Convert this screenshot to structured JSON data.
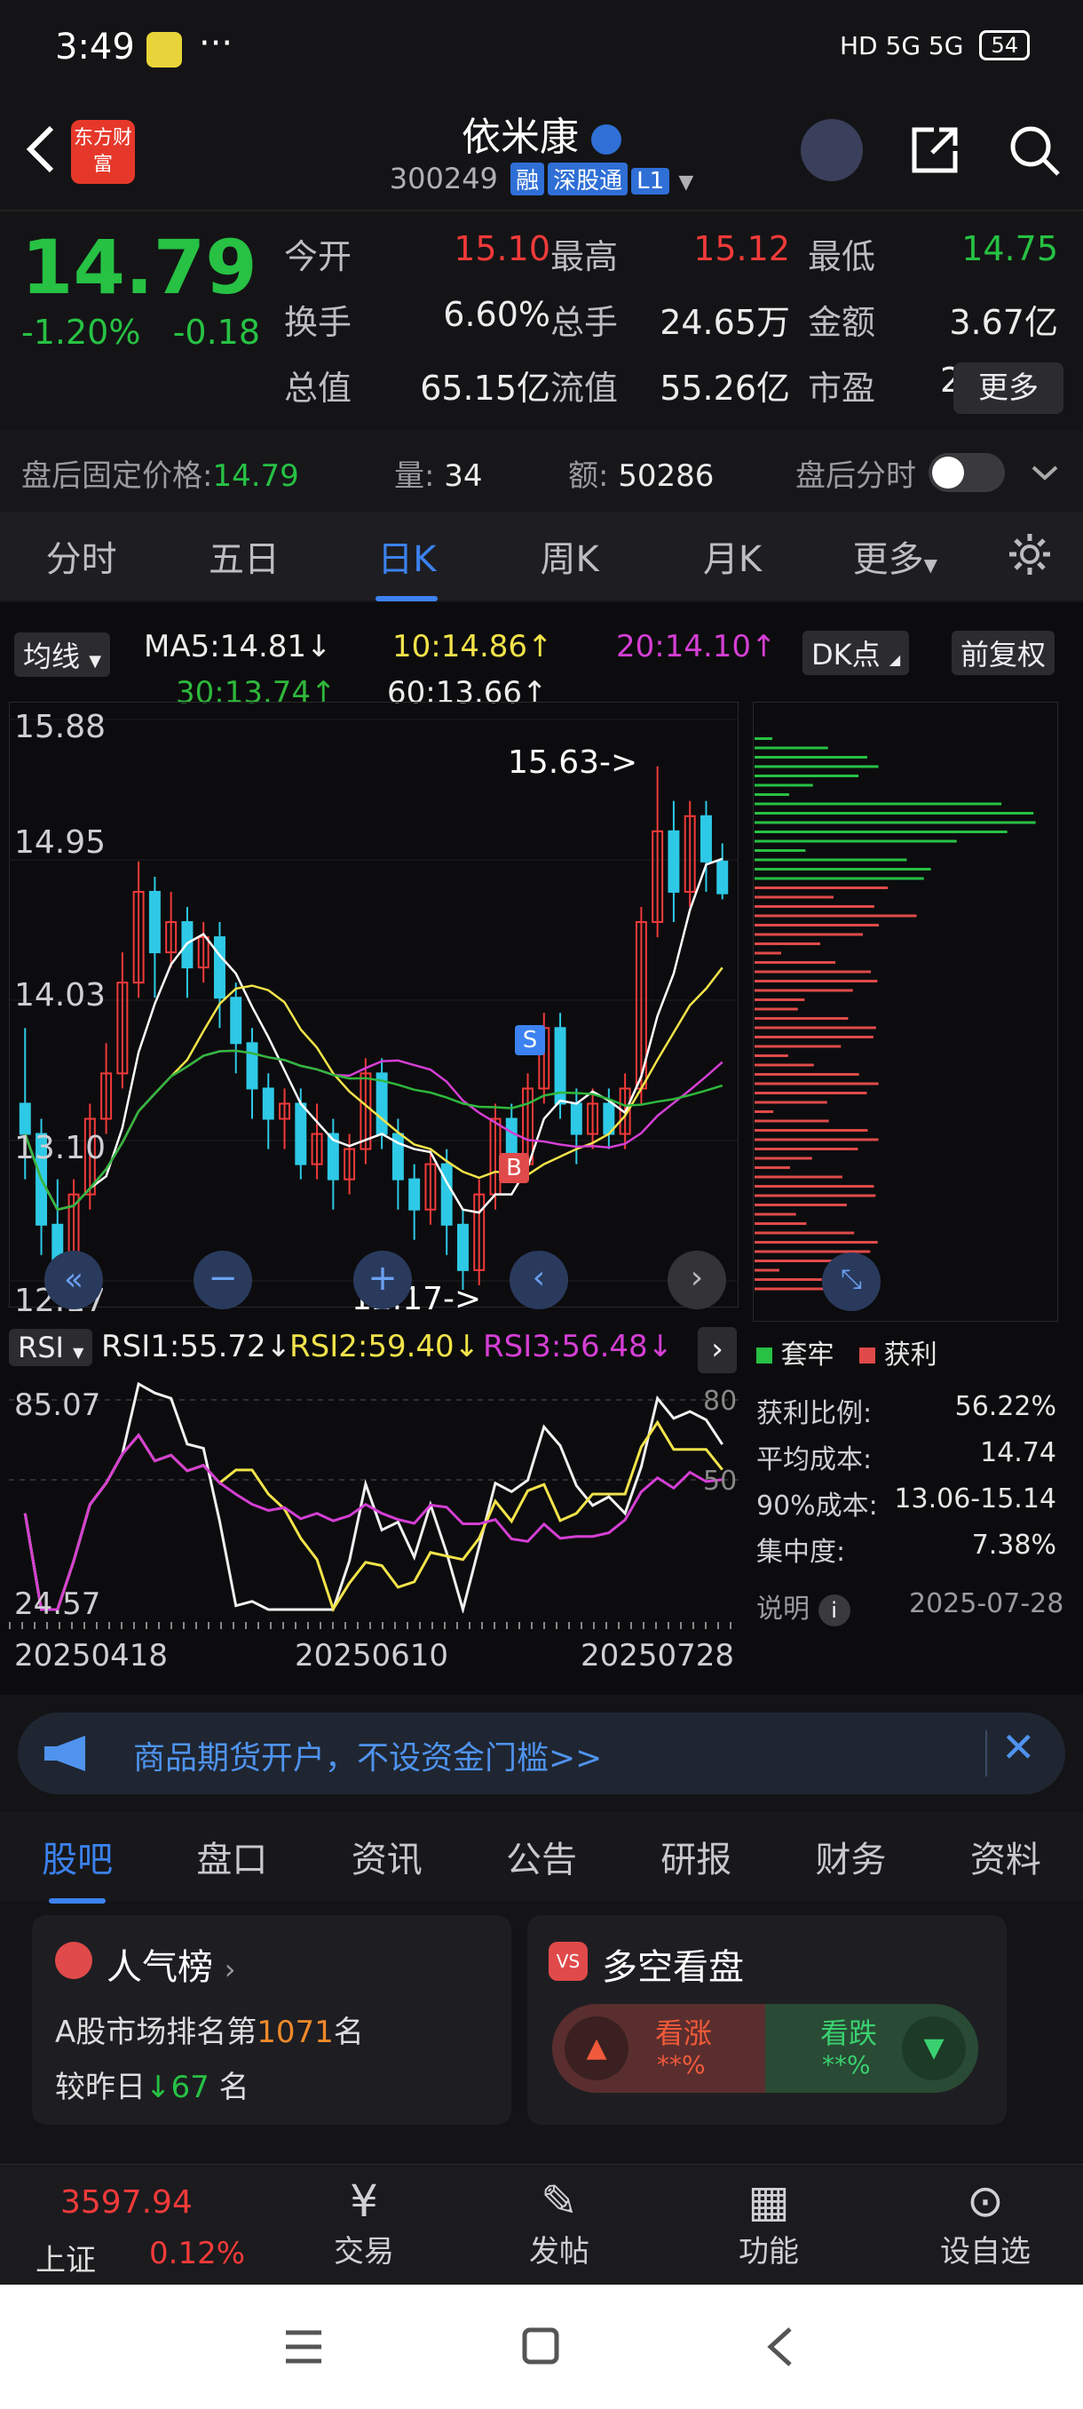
{
  "status_bar": {
    "time": "3:49",
    "dots": "···",
    "net": "HD 5G 5G",
    "battery": "54"
  },
  "header": {
    "title": "依米康",
    "code": "300249",
    "tags": [
      "融",
      "深股通",
      "L1"
    ],
    "logo_text": "东方财富"
  },
  "quote": {
    "price": "14.79",
    "change_pct": "-1.20%",
    "change": "-0.18",
    "fields": [
      {
        "label": "今开",
        "value": "15.10",
        "color": "red"
      },
      {
        "label": "最高",
        "value": "15.12",
        "color": "red"
      },
      {
        "label": "最低",
        "value": "14.75",
        "color": "green"
      },
      {
        "label": "换手",
        "value": "6.60%",
        "color": "white"
      },
      {
        "label": "总手",
        "value": "24.65万",
        "color": "white"
      },
      {
        "label": "金额",
        "value": "3.67亿",
        "color": "white"
      },
      {
        "label": "总值",
        "value": "65.15亿",
        "color": "white"
      },
      {
        "label": "流值",
        "value": "55.26亿",
        "color": "white"
      },
      {
        "label": "市盈",
        "value": "231.37",
        "color": "white"
      }
    ],
    "more": "更多",
    "after_hours": {
      "label": "盘后固定价格:",
      "price": "14.79",
      "vol_label": "量:",
      "vol": "34",
      "amt_label": "额:",
      "amt": "50286",
      "timeline_label": "盘后分时"
    }
  },
  "tabs": [
    "分时",
    "五日",
    "日K",
    "周K",
    "月K",
    "更多"
  ],
  "active_tab": 2,
  "chart": {
    "ma_selector": "均线",
    "ma": {
      "ma5": "MA5:14.81",
      "ma10": "10:14.86",
      "ma20": "20:14.10",
      "ma30": "30:13.74",
      "ma60": "60:13.66"
    },
    "dk": "DK点",
    "adjust": "前复权",
    "yticks": [
      "15.88",
      "14.95",
      "14.03",
      "13.10",
      "12.17"
    ],
    "high_label": "15.63->",
    "low_label": "12.17->",
    "rsi": {
      "selector": "RSI",
      "rsi1": "RSI1:55.72",
      "rsi2": "RSI2:59.40",
      "rsi3": "RSI3:56.48",
      "top": "85.07",
      "bottom": "24.57",
      "line80": "80",
      "line50": "50"
    },
    "dates": [
      "20250418",
      "20250610",
      "20250728"
    ],
    "chip_legend": {
      "trapped": "套牢",
      "profit": "获利"
    },
    "chip_stats": [
      {
        "label": "获利比例:",
        "value": "56.22%"
      },
      {
        "label": "平均成本:",
        "value": "14.74"
      },
      {
        "label": "90%成本:",
        "value": "13.06-15.14"
      },
      {
        "label": "集中度:",
        "value": "7.38%"
      }
    ],
    "note_label": "说明",
    "note_date": "2025-07-28"
  },
  "banner": {
    "text": "商品期货开户，不设资金门槛>>"
  },
  "bottom_tabs": [
    "股吧",
    "盘口",
    "资讯",
    "公告",
    "研报",
    "财务",
    "资料"
  ],
  "popularity": {
    "title": "人气榜",
    "rank_prefix": "A股市场排名第",
    "rank": "1071",
    "rank_suffix": "名",
    "change_prefix": "较昨日",
    "change": "67",
    "change_suffix": "名"
  },
  "longshort": {
    "title": "多空看盘",
    "up": "看涨",
    "up_val": "**%",
    "down": "看跌",
    "down_val": "**%"
  },
  "nav": {
    "index_value": "3597.94",
    "index_name": "上证",
    "index_pct": "0.12%",
    "items": [
      "交易",
      "发帖",
      "功能",
      "设自选"
    ]
  },
  "chart_data": {
    "type": "candlestick",
    "x_labels": [
      "20250418",
      "20250610",
      "20250728"
    ],
    "ylim": [
      12.17,
      15.88
    ],
    "candles": [
      [
        13.4,
        13.2,
        13.9,
        12.9
      ],
      [
        13.2,
        12.6,
        13.3,
        12.4
      ],
      [
        12.6,
        12.3,
        12.9,
        12.17
      ],
      [
        12.3,
        12.8,
        12.9,
        12.2
      ],
      [
        12.8,
        13.3,
        13.4,
        12.7
      ],
      [
        13.3,
        13.6,
        13.8,
        13.2
      ],
      [
        13.6,
        14.2,
        14.4,
        13.5
      ],
      [
        14.2,
        14.8,
        15.0,
        14.1
      ],
      [
        14.8,
        14.4,
        14.9,
        14.1
      ],
      [
        14.4,
        14.6,
        14.8,
        14.3
      ],
      [
        14.6,
        14.3,
        14.7,
        14.1
      ],
      [
        14.3,
        14.5,
        14.6,
        14.2
      ],
      [
        14.5,
        14.1,
        14.6,
        13.9
      ],
      [
        14.1,
        13.8,
        14.2,
        13.6
      ],
      [
        13.8,
        13.5,
        13.9,
        13.3
      ],
      [
        13.5,
        13.3,
        13.6,
        13.1
      ],
      [
        13.3,
        13.4,
        13.5,
        13.1
      ],
      [
        13.4,
        13.0,
        13.5,
        12.9
      ],
      [
        13.0,
        13.2,
        13.4,
        12.9
      ],
      [
        13.2,
        12.9,
        13.3,
        12.7
      ],
      [
        12.9,
        13.1,
        13.2,
        12.8
      ],
      [
        13.1,
        13.6,
        13.7,
        13.0
      ],
      [
        13.6,
        13.2,
        13.7,
        13.1
      ],
      [
        13.2,
        12.9,
        13.3,
        12.7
      ],
      [
        12.9,
        12.7,
        13.0,
        12.5
      ],
      [
        12.7,
        13.0,
        13.1,
        12.6
      ],
      [
        13.0,
        12.6,
        13.1,
        12.4
      ],
      [
        12.6,
        12.3,
        12.7,
        12.17
      ],
      [
        12.3,
        12.8,
        12.9,
        12.2
      ],
      [
        12.8,
        13.3,
        13.4,
        12.7
      ],
      [
        13.3,
        13.0,
        13.4,
        12.9
      ],
      [
        13.0,
        13.5,
        13.6,
        12.9
      ],
      [
        13.5,
        13.9,
        14.0,
        13.4
      ],
      [
        13.9,
        13.4,
        14.0,
        13.3
      ],
      [
        13.4,
        13.2,
        13.5,
        13.0
      ],
      [
        13.2,
        13.4,
        13.5,
        13.1
      ],
      [
        13.4,
        13.2,
        13.5,
        13.1
      ],
      [
        13.2,
        13.5,
        13.6,
        13.1
      ],
      [
        13.5,
        14.6,
        14.7,
        13.4
      ],
      [
        14.6,
        15.2,
        15.63,
        14.5
      ],
      [
        15.2,
        14.8,
        15.4,
        14.6
      ],
      [
        14.8,
        15.3,
        15.4,
        14.7
      ],
      [
        15.3,
        15.0,
        15.4,
        14.8
      ],
      [
        15.0,
        14.79,
        15.12,
        14.75
      ]
    ]
  }
}
